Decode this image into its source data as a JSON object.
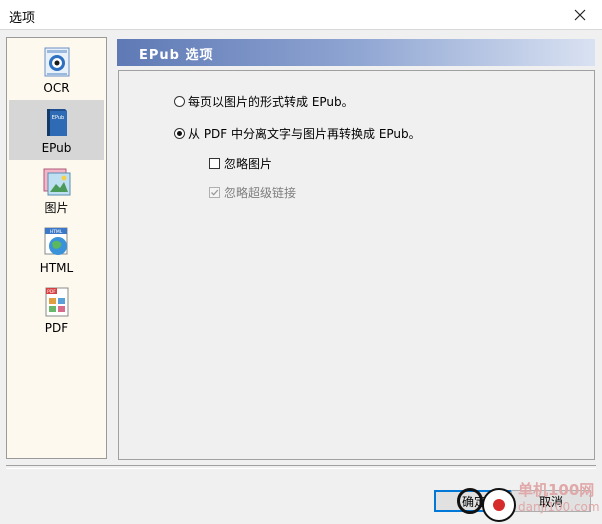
{
  "window": {
    "title": "选项"
  },
  "sidebar": {
    "items": [
      {
        "label": "OCR",
        "selected": false
      },
      {
        "label": "EPub",
        "selected": true
      },
      {
        "label": "图片",
        "selected": false
      },
      {
        "label": "HTML",
        "selected": false
      },
      {
        "label": "PDF",
        "selected": false
      }
    ]
  },
  "section": {
    "header": "EPub 选项"
  },
  "options": {
    "radio_per_page": {
      "label": "每页以图片的形式转成 EPub。",
      "checked": false
    },
    "radio_separate": {
      "label": "从 PDF 中分离文字与图片再转换成 EPub。",
      "checked": true
    },
    "check_ignore_images": {
      "label": "忽略图片",
      "checked": false,
      "enabled": true
    },
    "check_ignore_links": {
      "label": "忽略超级链接",
      "checked": true,
      "enabled": false
    }
  },
  "buttons": {
    "ok": "确定",
    "cancel": "取消"
  },
  "watermark": {
    "line1": "单机100网",
    "line2": "danji100.com"
  },
  "colors": {
    "accent": "#0078d7",
    "header_start": "#5e79b5",
    "header_end": "#d9e2f2",
    "sidebar_bg": "#fdf9ef"
  }
}
